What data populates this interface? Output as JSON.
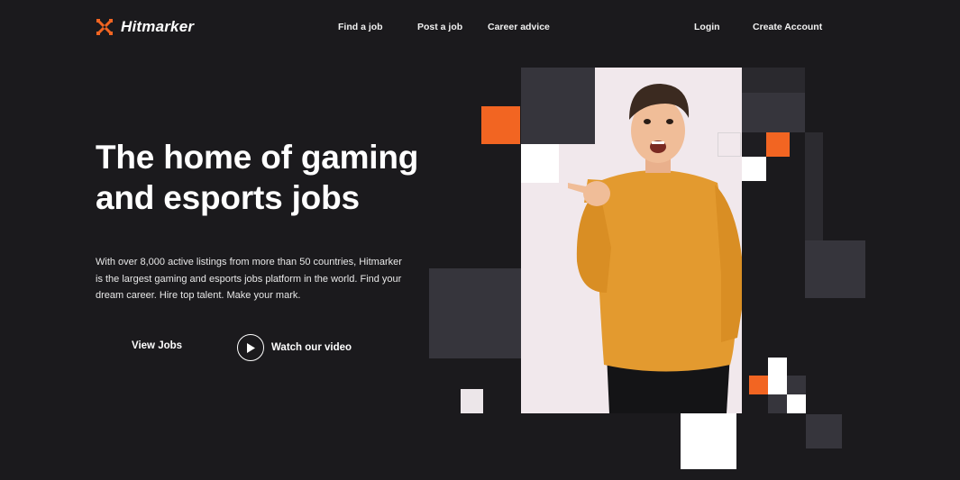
{
  "brand": {
    "name": "Hitmarker",
    "accent": "#f26522",
    "logo_icon": "crosshair-x-icon"
  },
  "nav": {
    "find_job": "Find a job",
    "post_job": "Post a job",
    "career_advice": "Career advice",
    "login": "Login",
    "create_account": "Create Account"
  },
  "hero": {
    "title_line1": "The home of gaming",
    "title_line2": "and esports jobs",
    "description": "With over 8,000 active listings from more than 50 countries, Hitmarker is the largest gaming and esports jobs platform in the world. Find your dream career. Hire top talent. Make your mark.",
    "view_jobs": "View Jobs",
    "watch_video": "Watch our video",
    "watch_icon": "play-icon"
  },
  "colors": {
    "background": "#1b1a1d",
    "dark_block": "#36353c",
    "photo_bg": "#f1e8ec",
    "sweater": "#e39a2f",
    "white": "#ffffff"
  }
}
